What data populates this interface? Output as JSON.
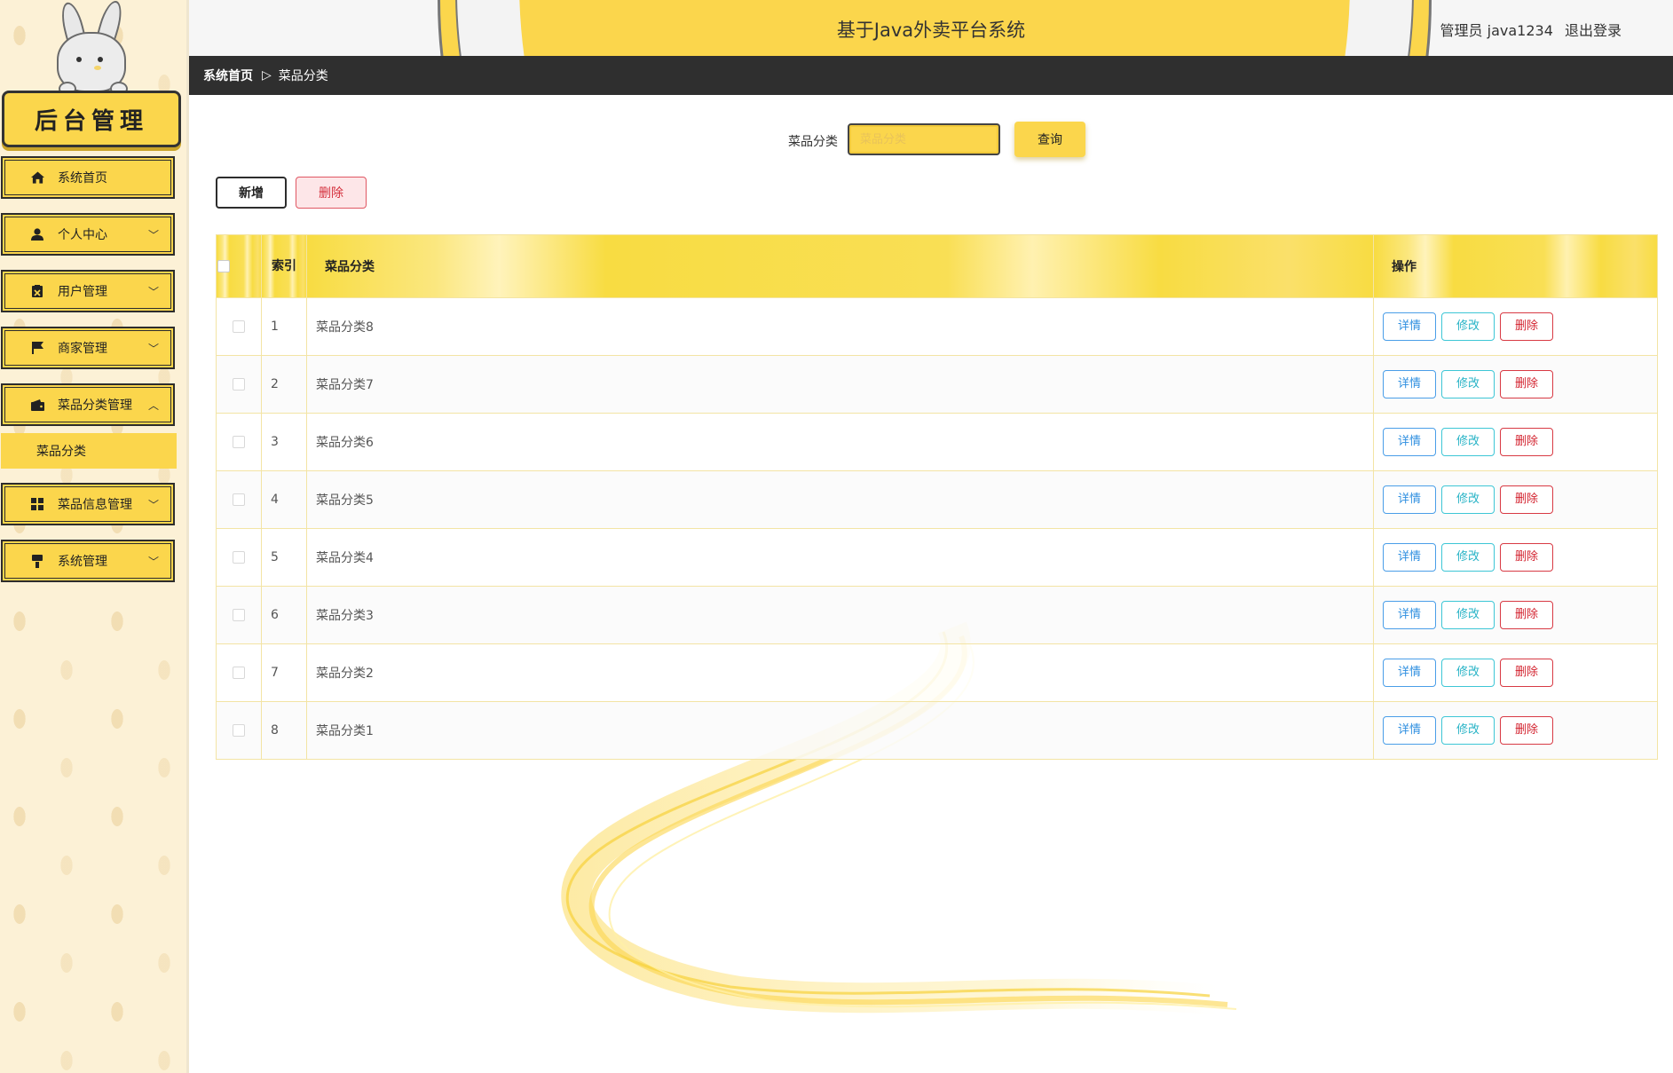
{
  "sidebar": {
    "logo_text": "后台管理",
    "items": [
      {
        "label": "系统首页",
        "icon": "home-icon",
        "has_chevron": false
      },
      {
        "label": "个人中心",
        "icon": "person-icon",
        "has_chevron": true
      },
      {
        "label": "用户管理",
        "icon": "clipboard-icon",
        "has_chevron": true
      },
      {
        "label": "商家管理",
        "icon": "flag-icon",
        "has_chevron": true
      },
      {
        "label": "菜品分类管理",
        "icon": "wallet-icon",
        "has_chevron": true,
        "expanded": true,
        "children": [
          {
            "label": "菜品分类"
          }
        ]
      },
      {
        "label": "菜品信息管理",
        "icon": "grid-icon",
        "has_chevron": true
      },
      {
        "label": "系统管理",
        "icon": "brush-icon",
        "has_chevron": true
      }
    ]
  },
  "header": {
    "title": "基于Java外卖平台系统",
    "user": "管理员 java1234",
    "logout": "退出登录"
  },
  "breadcrumb": {
    "home": "系统首页",
    "current": "菜品分类"
  },
  "search": {
    "label": "菜品分类",
    "placeholder": "菜品分类",
    "button": "查询"
  },
  "actions": {
    "add": "新增",
    "delete": "删除"
  },
  "table": {
    "columns": [
      "索引",
      "菜品分类",
      "操作"
    ],
    "op_labels": {
      "detail": "详情",
      "edit": "修改",
      "delete": "删除"
    },
    "rows": [
      {
        "index": "1",
        "name": "菜品分类8"
      },
      {
        "index": "2",
        "name": "菜品分类7"
      },
      {
        "index": "3",
        "name": "菜品分类6"
      },
      {
        "index": "4",
        "name": "菜品分类5"
      },
      {
        "index": "5",
        "name": "菜品分类4"
      },
      {
        "index": "6",
        "name": "菜品分类3"
      },
      {
        "index": "7",
        "name": "菜品分类2"
      },
      {
        "index": "8",
        "name": "菜品分类1"
      }
    ]
  },
  "colors": {
    "accent": "#fbd64c",
    "dark_bar": "#2f2f2f",
    "detail": "#2f8fe0",
    "edit": "#27b3c6",
    "danger": "#d3232f"
  }
}
